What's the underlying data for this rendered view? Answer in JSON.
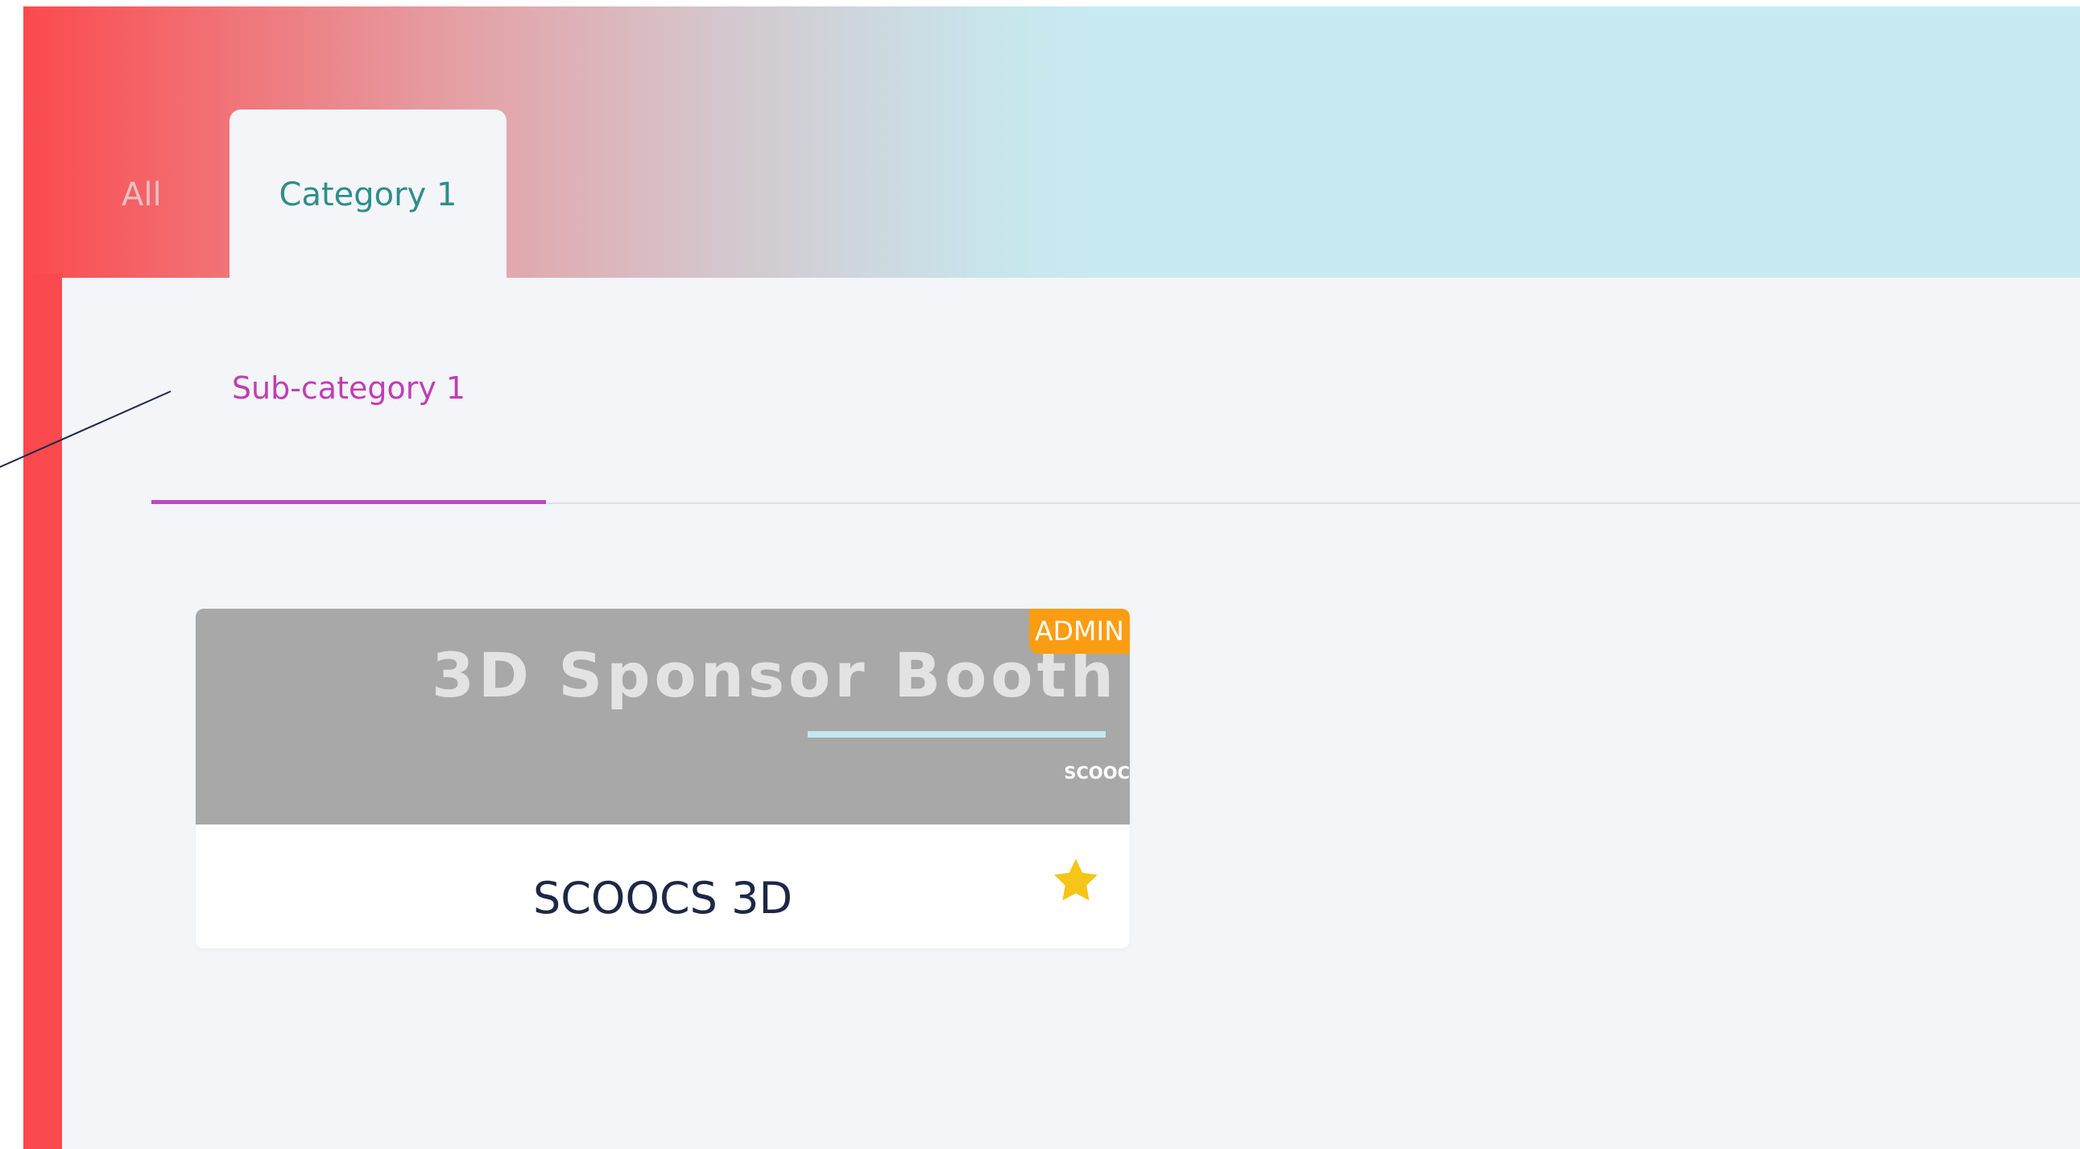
{
  "tabs": [
    {
      "label": "All",
      "active": false
    },
    {
      "label": "Category 1",
      "active": true
    }
  ],
  "subtabs": [
    {
      "label": "Sub-category 1",
      "active": true
    }
  ],
  "card": {
    "badge": "ADMIN",
    "banner_title": "3D Sponsor Booth",
    "banner_logo": "SCOOC",
    "title": "SCOOCS 3D",
    "favorite_icon": "star-icon",
    "favorited": true
  },
  "colors": {
    "brand_red": "#fb4a4d",
    "header_light_blue": "#c8ebf1",
    "active_tab_text": "#2e8e8b",
    "subtab_accent": "#c03fb2",
    "admin_badge": "#fb9d12",
    "star": "#f5c518",
    "card_title": "#1d2746"
  }
}
